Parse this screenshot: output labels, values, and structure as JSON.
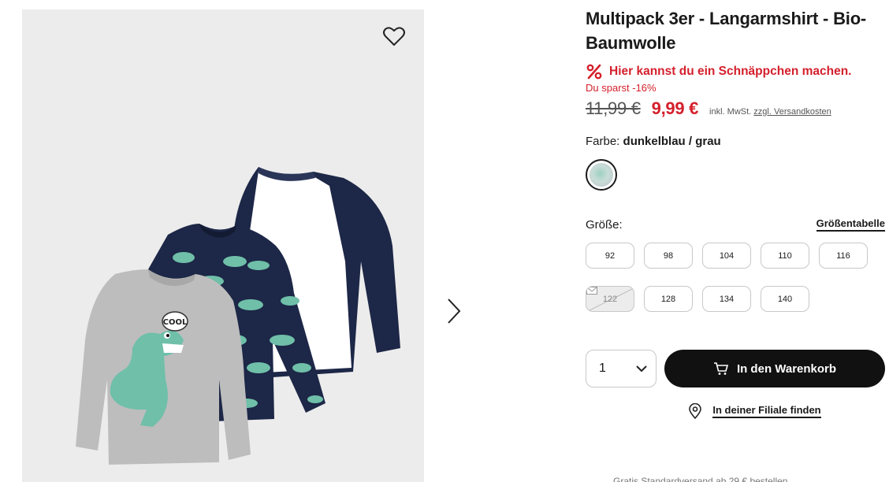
{
  "product": {
    "title": "Multipack 3er - Langarmshirt - Bio-Baumwolle",
    "deal_text": "Hier kannst du ein Schnäppchen machen.",
    "savings": "Du sparst -16%",
    "old_price": "11,99 €",
    "new_price": "9,99 €",
    "tax_text": "inkl. MwSt.",
    "shipping_link": "zzgl. Versandkosten",
    "color_label": "Farbe:",
    "color_value": "dunkelblau / grau",
    "size_label": "Größe:",
    "size_table_link": "Größentabelle",
    "sizes": [
      {
        "label": "92",
        "available": true
      },
      {
        "label": "98",
        "available": true
      },
      {
        "label": "104",
        "available": true
      },
      {
        "label": "110",
        "available": true
      },
      {
        "label": "116",
        "available": true
      },
      {
        "label": "122",
        "available": false
      },
      {
        "label": "128",
        "available": true
      },
      {
        "label": "134",
        "available": true
      },
      {
        "label": "140",
        "available": true
      }
    ],
    "quantity": "1",
    "add_to_cart": "In den Warenkorb",
    "store_link": "In deiner Filiale finden",
    "cut_text": "Gratis Standardversand ab 29 € bestellen",
    "image_text": "COOL"
  },
  "colors": {
    "accent": "#d4202c",
    "button": "#111111",
    "image_bg": "#ececec"
  },
  "icons": [
    "heart-icon",
    "chevron-right-icon",
    "percent-icon",
    "chevron-down-icon",
    "cart-icon",
    "location-pin-icon",
    "mail-icon"
  ]
}
